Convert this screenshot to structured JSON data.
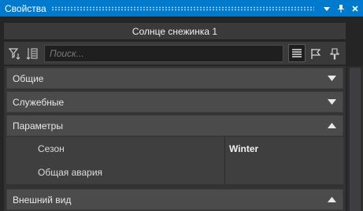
{
  "window": {
    "title": "Свойства"
  },
  "object": {
    "name": "Солнце снежинка 1"
  },
  "toolbar": {
    "search_placeholder": "Поиск...",
    "buttons": [
      "filter-icon",
      "sort-icon",
      "list-view-icon",
      "flag-icon",
      "pin-icon"
    ]
  },
  "sections": {
    "general": {
      "label": "Общие",
      "expanded": false
    },
    "service": {
      "label": "Служебные",
      "expanded": false
    },
    "parameters": {
      "label": "Параметры",
      "expanded": true
    },
    "appearance": {
      "label": "Внешний вид",
      "expanded": true
    }
  },
  "properties": [
    {
      "name": "Сезон",
      "value": "Winter"
    },
    {
      "name": "Общая авария",
      "value": ""
    }
  ],
  "colors": {
    "accent": "#007acc",
    "panel": "#333333",
    "section": "#4b4b4b"
  }
}
